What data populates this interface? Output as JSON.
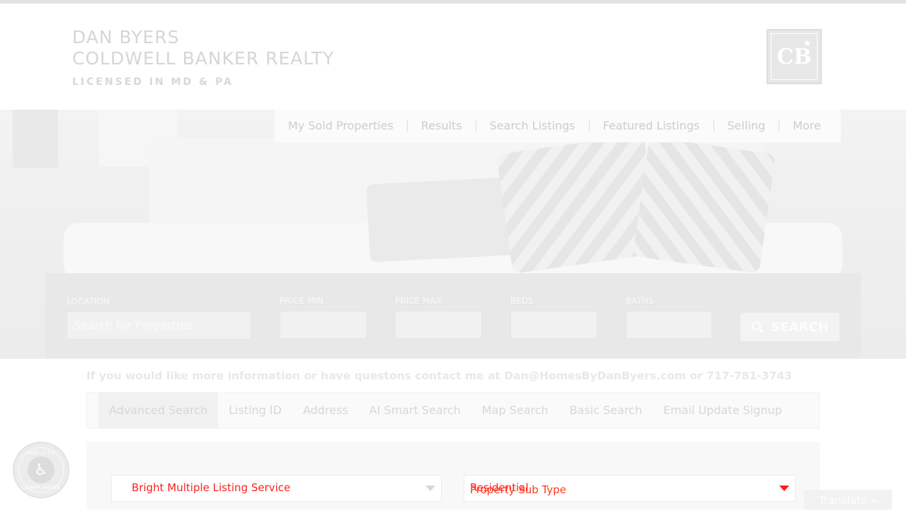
{
  "header": {
    "agent_name": "DAN BYERS",
    "company": "COLDWELL BANKER REALTY",
    "license": "LICENSED IN MD & PA",
    "logo_text": "CB"
  },
  "nav": {
    "items": [
      "My Sold Properties",
      "Results",
      "Search Listings",
      "Featured Listings",
      "Selling",
      "More"
    ]
  },
  "search": {
    "location_label": "LOCATION",
    "location_placeholder": "Search for Properties",
    "price_min_label": "PRICE MIN",
    "price_max_label": "PRICE MAX",
    "beds_label": "BEDS",
    "baths_label": "BATHS",
    "button_label": "SEARCH"
  },
  "info_text": "If you would like more information or have questons contact me at Dan@HomesByDanByers.com or 717-781-3743",
  "tabs": [
    "Advanced Search",
    "Listing ID",
    "Address",
    "AI Smart Search",
    "Map Search",
    "Basic Search",
    "Email Update Signup"
  ],
  "advanced": {
    "mls_select": "Bright Multiple Listing Service",
    "type_select": "Residential",
    "subtype_select": "Property Sub Type"
  },
  "ada": {
    "top_text": "ADA SITE",
    "bottom_text": "COMPLIANCE"
  },
  "translate_label": "Translate »",
  "colors": {
    "highlight_text": "#ff2020",
    "highlight_text_alt": "#ffcc00",
    "caret_accent": "#ff1a1a"
  }
}
